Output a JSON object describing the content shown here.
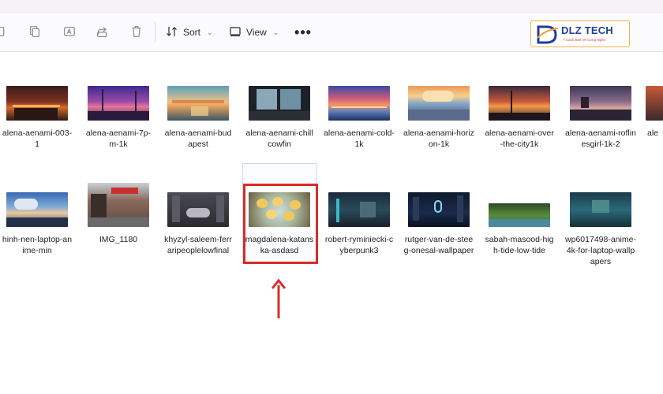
{
  "toolbar": {
    "sort_label": "Sort",
    "view_label": "View",
    "more_label": "•••",
    "icons": [
      "copy-icon",
      "rename-icon",
      "share-icon",
      "delete-icon",
      "sort-icon",
      "view-icon"
    ]
  },
  "logo": {
    "text": "DLZ TECH",
    "tagline": "T Cach Biet Ve Cong Nghe"
  },
  "files": [
    {
      "name": "alena-aenami-003-1",
      "thumb": "sunset-city"
    },
    {
      "name": "alena-aenami-7p-m-1k",
      "thumb": "purple-dusk"
    },
    {
      "name": "alena-aenami-budapest",
      "thumb": "budapest"
    },
    {
      "name": "alena-aenami-chillcowfin",
      "thumb": "window-view"
    },
    {
      "name": "alena-aenami-cold-1k",
      "thumb": "cold-sky"
    },
    {
      "name": "alena-aenami-horizon-1k",
      "thumb": "horizon"
    },
    {
      "name": "alena-aenami-over-the-city1k",
      "thumb": "over-city"
    },
    {
      "name": "alena-aenami-roflinesgirl-1k-2",
      "thumb": "rooftop-girl"
    },
    {
      "name": "hinh-nen-laptop-anime-min",
      "thumb": "anime-sky"
    },
    {
      "name": "IMG_1180",
      "thumb": "street-photo"
    },
    {
      "name": "khyzyl-saleem-ferraripeoplelowfinal",
      "thumb": "car-street"
    },
    {
      "name": "magdalena-katanska-asdasd",
      "thumb": "ducklings"
    },
    {
      "name": "robert-ryminiecki-cyberpunk3",
      "thumb": "cyberpunk"
    },
    {
      "name": "rutger-van-de-steeg-onesal-wallpaper",
      "thumb": "neon-city"
    },
    {
      "name": "sabah-masood-high-tide-low-tide",
      "thumb": "forest-lake"
    },
    {
      "name": "wp6017498-anime-4k-for-laptop-wallpapers",
      "thumb": "teal-anime"
    }
  ],
  "colors": {
    "highlight": "#d92b2b",
    "accent": "#1f3f9a"
  }
}
